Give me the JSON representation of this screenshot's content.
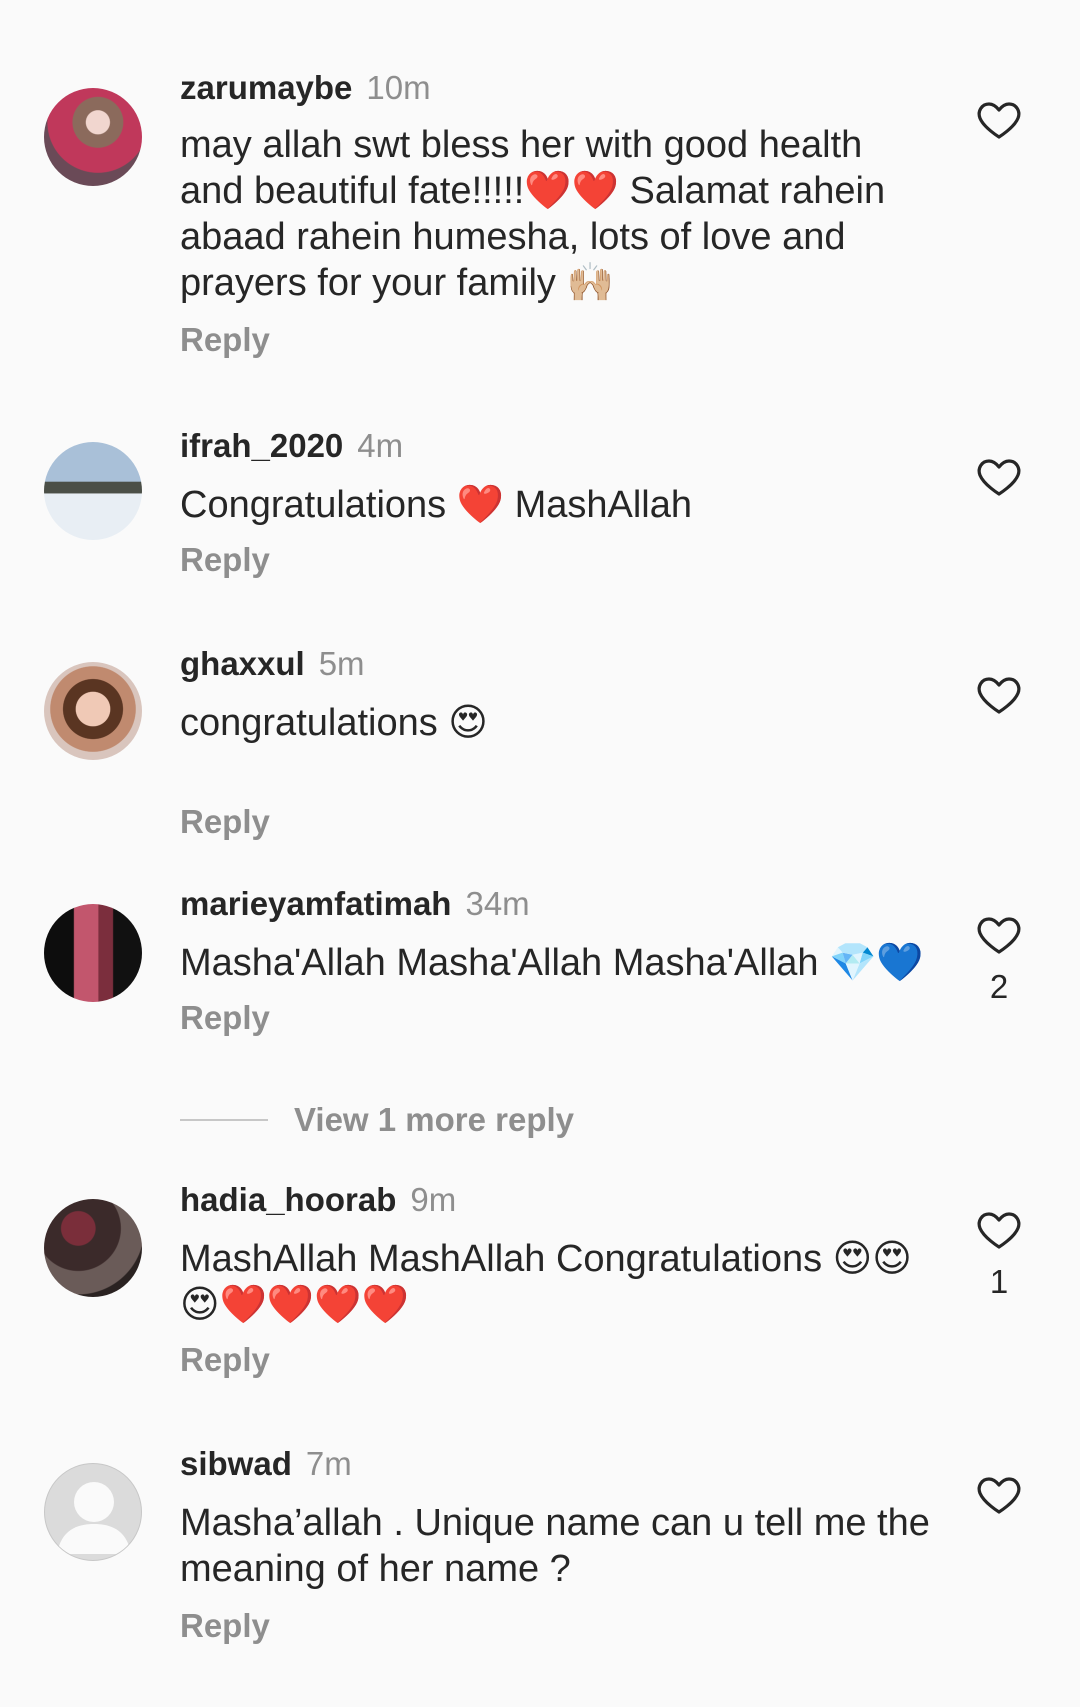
{
  "comments": [
    {
      "username": "zarumaybe",
      "time": "10m",
      "text": "may allah swt bless her with good health and beautiful fate!!!!!❤️❤️ Salamat rahein abaad rahein humesha, lots of love and prayers for your family 🙌🏼",
      "reply_label": "Reply",
      "like_count": ""
    },
    {
      "username": "ifrah_2020",
      "time": "4m",
      "text": "Congratulations ❤️ MashAllah",
      "reply_label": "Reply",
      "like_count": ""
    },
    {
      "username": "ghaxxul",
      "time": "5m",
      "text": "congratulations 😍",
      "reply_label": "Reply",
      "like_count": ""
    },
    {
      "username": "marieyamfatimah",
      "time": "34m",
      "text": "Masha'Allah Masha'Allah Masha'Allah 💎💙",
      "reply_label": "Reply",
      "like_count": "2"
    },
    {
      "username": "hadia_hoorab",
      "time": "9m",
      "text": "MashAllah  MashAllah  Congratulations 😍😍😍❤️❤️❤️❤️",
      "reply_label": "Reply",
      "like_count": "1"
    },
    {
      "username": "sibwad",
      "time": "7m",
      "text": "Masha’allah . Unique name can u tell me the meaning of her name ?",
      "reply_label": "Reply",
      "like_count": ""
    }
  ],
  "view_more_replies": "View 1 more reply",
  "icons": {
    "like": "heart-outline-icon",
    "default_avatar": "default-avatar-icon"
  },
  "colors": {
    "background": "#fafafa",
    "text": "#262626",
    "secondary": "#8e8e8e",
    "divider": "#c7c7c7"
  }
}
